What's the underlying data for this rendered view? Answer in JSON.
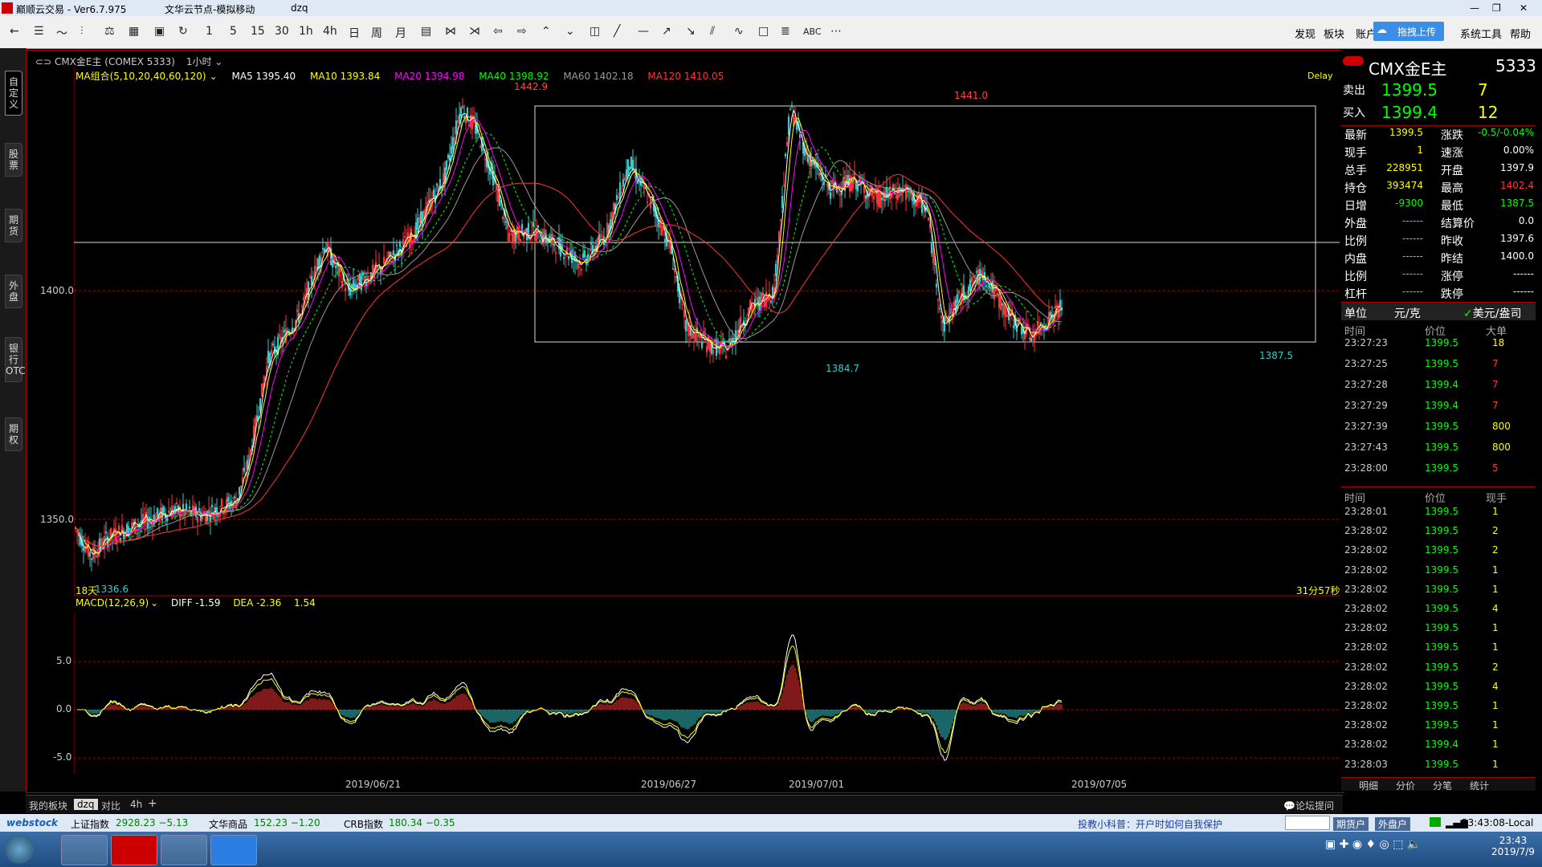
{
  "window": {
    "app_title": "巅顺云交易 - Ver6.7.975",
    "node": "文华云节点-模拟移动",
    "user": "dzq"
  },
  "toolbar": {
    "periods": [
      "1",
      "5",
      "15",
      "30",
      "1h",
      "4h",
      "日",
      "周",
      "月"
    ],
    "menu_right": [
      "发现",
      "板块",
      "账户",
      "拖拽上传",
      "系统工具",
      "帮助"
    ],
    "drawing_tool_text": "ABC"
  },
  "left_tabs": [
    "自定义",
    "股票",
    "期货",
    "外盘",
    "银行OTC",
    "期权"
  ],
  "chart_header": {
    "symbol": "CMX金E主 (COMEX 5333)",
    "period": "1小时",
    "delay": "Delay"
  },
  "ma_line": {
    "title": "MA组合(5,10,20,40,60,120)",
    "items": [
      {
        "label": "MA5 1395.40",
        "color": "#ffffff"
      },
      {
        "label": "MA10 1393.84",
        "color": "#ffff00"
      },
      {
        "label": "MA20 1394.98",
        "color": "#ff00ff"
      },
      {
        "label": "MA40 1398.92",
        "color": "#00ff00"
      },
      {
        "label": "MA60 1402.18",
        "color": "#999999"
      },
      {
        "label": "MA120 1410.05",
        "color": "#ff3333"
      }
    ]
  },
  "chart_labels": {
    "high1": "1442.9",
    "high2": "1441.0",
    "low1": "1384.7",
    "low2": "1387.5",
    "low0": "1336.6",
    "days": "18天",
    "y1400": "1400.0",
    "y1350": "1350.0",
    "countdown": "31分57秒"
  },
  "macd": {
    "title": "MACD(12,26,9)",
    "diff": "DIFF -1.59",
    "dea": "DEA -2.36",
    "macd": "1.54",
    "y_labels": [
      "5.0",
      "0.0",
      "-5.0"
    ]
  },
  "dates": [
    "2019/06/21",
    "2019/06/27",
    "2019/07/01",
    "2019/07/05"
  ],
  "quote": {
    "name": "CMX金E主",
    "code": "5333",
    "sell_label": "卖出",
    "sell_price": "1399.5",
    "sell_vol": "7",
    "buy_label": "买入",
    "buy_price": "1399.4",
    "buy_vol": "12",
    "stats": [
      [
        "最新",
        "1399.5",
        "涨跌",
        "-0.5/-0.04%"
      ],
      [
        "现手",
        "1",
        "速涨",
        "0.00%"
      ],
      [
        "总手",
        "228951",
        "开盘",
        "1397.9"
      ],
      [
        "持仓",
        "393474",
        "最高",
        "1402.4"
      ],
      [
        "日增",
        "-9300",
        "最低",
        "1387.5"
      ],
      [
        "外盘",
        "------",
        "结算价",
        "0.0"
      ],
      [
        "比例",
        "------",
        "昨收",
        "1397.6"
      ],
      [
        "内盘",
        "------",
        "昨结",
        "1400.0"
      ],
      [
        "比例",
        "------",
        "涨停",
        "------"
      ],
      [
        "杠杆",
        "------",
        "跌停",
        "------"
      ]
    ],
    "unit_label": "单位",
    "unit_cny": "元/克",
    "unit_usd": "美元/盎司"
  },
  "big_orders": {
    "headers": [
      "时间",
      "价位",
      "大单"
    ],
    "rows": [
      [
        "23:27:23",
        "1399.5",
        "18"
      ],
      [
        "23:27:25",
        "1399.5",
        "7"
      ],
      [
        "23:27:28",
        "1399.4",
        "7"
      ],
      [
        "23:27:29",
        "1399.4",
        "7"
      ],
      [
        "23:27:39",
        "1399.5",
        "800"
      ],
      [
        "23:27:43",
        "1399.5",
        "800"
      ],
      [
        "23:28:00",
        "1399.5",
        "5"
      ]
    ]
  },
  "ticks": {
    "headers": [
      "时间",
      "价位",
      "现手"
    ],
    "rows": [
      [
        "23:28:01",
        "1399.5",
        "1"
      ],
      [
        "23:28:02",
        "1399.5",
        "2"
      ],
      [
        "23:28:02",
        "1399.5",
        "2"
      ],
      [
        "23:28:02",
        "1399.5",
        "1"
      ],
      [
        "23:28:02",
        "1399.5",
        "1"
      ],
      [
        "23:28:02",
        "1399.5",
        "4"
      ],
      [
        "23:28:02",
        "1399.5",
        "1"
      ],
      [
        "23:28:02",
        "1399.5",
        "1"
      ],
      [
        "23:28:02",
        "1399.5",
        "2"
      ],
      [
        "23:28:02",
        "1399.5",
        "4"
      ],
      [
        "23:28:02",
        "1399.5",
        "1"
      ],
      [
        "23:28:02",
        "1399.5",
        "1"
      ],
      [
        "23:28:02",
        "1399.4",
        "1"
      ],
      [
        "23:28:03",
        "1399.5",
        "1"
      ]
    ],
    "tabs": [
      "明细",
      "分价",
      "分笔",
      "统计"
    ]
  },
  "bottom_tabs": [
    "我的板块",
    "dzq",
    "对比",
    "4h",
    "+"
  ],
  "forum": "论坛提问",
  "status": {
    "brand": "webstock",
    "sh_index": "上证指数",
    "sh_value": "2928.23 −5.13",
    "wh_label": "文华商品",
    "wh_value": "152.23 −1.20",
    "crb_label": "CRB指数",
    "crb_value": "180.34 −0.35",
    "tip": "投教小科普：开户时如何自我保护",
    "btn_futures": "期货户",
    "btn_foreign": "外盘户",
    "time_local": "23:43:08-Local"
  },
  "taskbar": {
    "clock": "23:43",
    "date": "2019/7/9"
  },
  "colors": {
    "up": "#ff3333",
    "down": "#33cccc",
    "accent": "#00ff00"
  }
}
